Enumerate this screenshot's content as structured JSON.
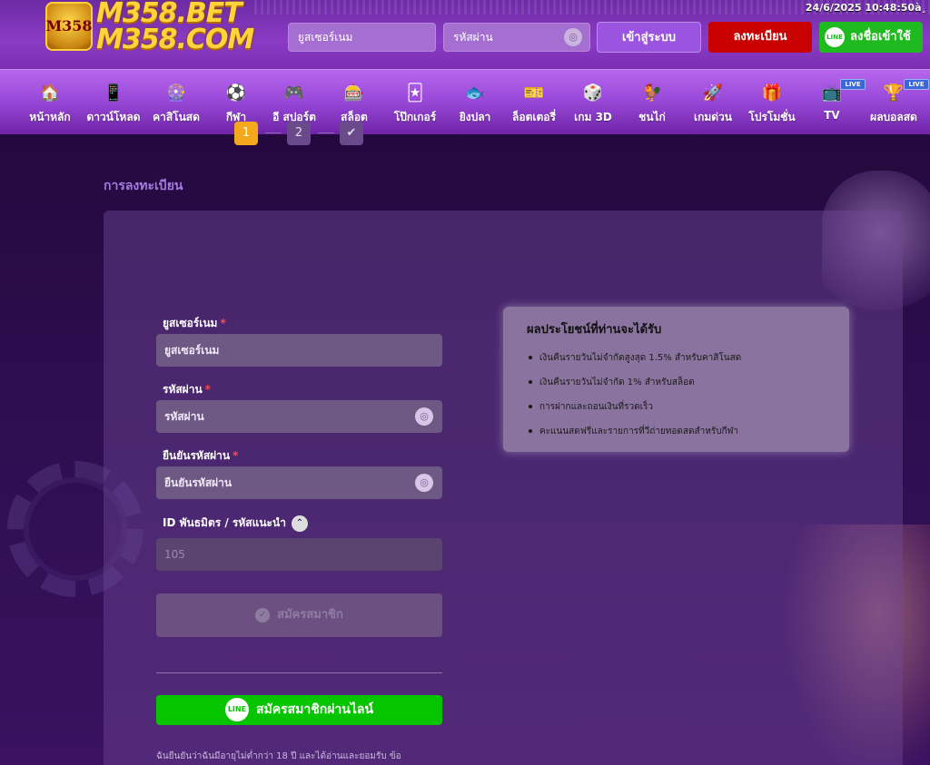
{
  "header": {
    "logo_line1": "M358.BET",
    "logo_line2": "M358.COM",
    "logo_badge": "M358",
    "datetime": "24/6/2025 10:48:50à¸",
    "username_placeholder": "ยูสเซอร์เนม",
    "password_placeholder": "รหัสผ่าน",
    "login_label": "เข้าสู่ระบบ",
    "register_label": "ลงทะเบียน",
    "line_login_label": "ลงชื่อเข้าใช้",
    "line_badge": "LINE"
  },
  "nav": {
    "live_tag": "LIVE",
    "items": [
      {
        "label": "หน้าหลัก",
        "icon": "home-icon",
        "glyph": "🏠"
      },
      {
        "label": "ดาวน์โหลด",
        "icon": "download-icon",
        "glyph": "📱"
      },
      {
        "label": "คาสิโนสด",
        "icon": "roulette-icon",
        "glyph": "🎡"
      },
      {
        "label": "กีฬา",
        "icon": "football-icon",
        "glyph": "⚽"
      },
      {
        "label": "อี สปอร์ต",
        "icon": "gamepad-icon",
        "glyph": "🎮"
      },
      {
        "label": "สล็อต",
        "icon": "slot-icon",
        "glyph": "🎰"
      },
      {
        "label": "โป๊กเกอร์",
        "icon": "cards-icon",
        "glyph": "🃏"
      },
      {
        "label": "ยิงปลา",
        "icon": "fish-icon",
        "glyph": "🐟"
      },
      {
        "label": "ล็อตเตอรี่",
        "icon": "lottery-icon",
        "glyph": "🎫"
      },
      {
        "label": "เกม 3D",
        "icon": "dice-icon",
        "glyph": "🎲"
      },
      {
        "label": "ชนไก่",
        "icon": "rooster-icon",
        "glyph": "🐓"
      },
      {
        "label": "เกมด่วน",
        "icon": "rocket-icon",
        "glyph": "🚀"
      },
      {
        "label": "โปรโมชั่น",
        "icon": "gift-icon",
        "glyph": "🎁"
      },
      {
        "label": "TV",
        "icon": "tv-icon",
        "glyph": "📺"
      },
      {
        "label": "ผลบอลสด",
        "icon": "trophy-icon",
        "glyph": "🏆"
      }
    ]
  },
  "page": {
    "title": "การลงทะเบียน"
  },
  "steps": [
    "1",
    "2",
    "✔"
  ],
  "form": {
    "username_label": "ยูสเซอร์เนม",
    "username_placeholder": "ยูสเซอร์เนม",
    "password_label": "รหัสผ่าน",
    "password_placeholder": "รหัสผ่าน",
    "confirm_label": "ยืนยันรหัสผ่าน",
    "confirm_placeholder": "ยืนยันรหัสผ่าน",
    "referral_label": "ID พันธมิตร / รหัสแนะนำ",
    "referral_value": "105",
    "required_mark": "*",
    "submit_label": "สมัครสมาชิก",
    "line_signup_label": "สมัครสมาชิกผ่านไลน์",
    "line_badge": "LINE",
    "terms": "ฉันยืนยันว่าฉันมีอายุไม่ต่ำกว่า 18 ปี และได้อ่านและยอมรับ ข้อ"
  },
  "benefits": {
    "title": "ผลประโยชน์ที่ท่านจะได้รับ",
    "items": [
      "เงินคืนรายวันไม่จำกัดสูงสุด 1.5% สำหรับคาสิโนสด",
      "เงินคืนรายวันไม่จำกัด 1% สำหรับสล็อต",
      "การฝากและถอนเงินที่รวดเร็ว",
      "คะแนนสดฟรีและรายการที่วีถ่ายทอดสดสำหรับกีฬา"
    ]
  },
  "colors": {
    "header_bg": "#7a2fb3",
    "nav_bg": "#9747d6",
    "register_red": "#c90000",
    "line_green": "#07c400",
    "step_active": "#f4a81c"
  }
}
